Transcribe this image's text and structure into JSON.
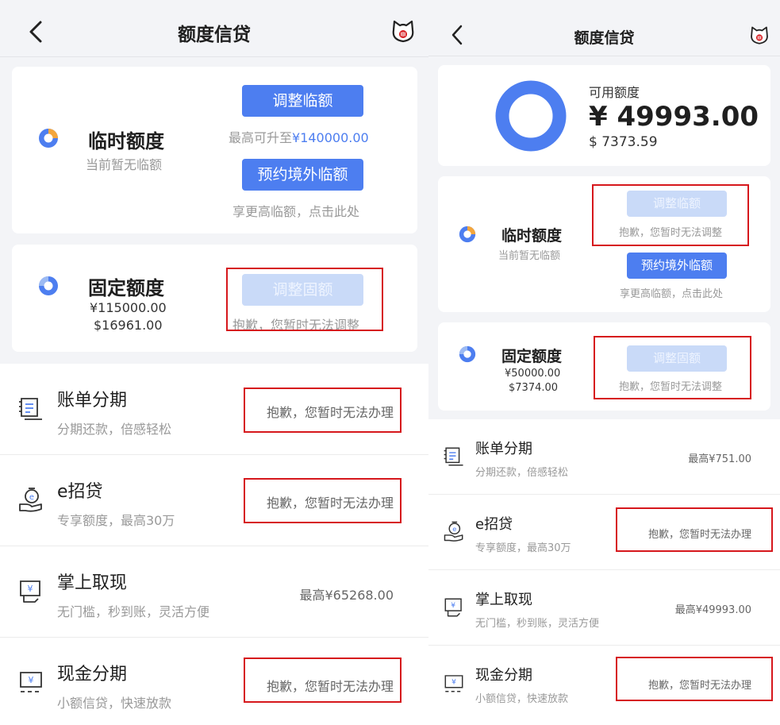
{
  "left": {
    "nav": {
      "title": "额度信贷"
    },
    "temp_card": {
      "title": "临时额度",
      "subtitle": "当前暂无临额",
      "btn_adjust": "调整临额",
      "max_prefix": "最高可升至",
      "max_value": "¥140000.00",
      "btn_overseas": "预约境外临额",
      "overseas_hint": "享更高临额，点击此处"
    },
    "fixed_card": {
      "title": "固定额度",
      "amount_cny": "¥115000.00",
      "amount_usd": "$16961.00",
      "btn_adjust": "调整固额",
      "notice": "抱歉，您暂时无法调整"
    },
    "items": [
      {
        "title": "账单分期",
        "subtitle": "分期还款，倍感轻松",
        "right": "抱歉，您暂时无法办理",
        "icon": "bill-installment-icon"
      },
      {
        "title": "e招贷",
        "subtitle": "专享额度，最高30万",
        "right": "抱歉，您暂时无法办理",
        "icon": "e-loan-icon"
      },
      {
        "title": "掌上取现",
        "subtitle": "无门槛，秒到账，灵活方便",
        "right": "最高¥65268.00",
        "icon": "cash-withdraw-icon"
      },
      {
        "title": "现金分期",
        "subtitle": "小额信贷，快速放款",
        "right": "抱歉，您暂时无法办理",
        "icon": "cash-installment-icon"
      }
    ]
  },
  "right": {
    "nav": {
      "title": "额度信贷"
    },
    "available": {
      "label": "可用额度",
      "amount_cny": "¥ 49993.00",
      "amount_usd": "$ 7373.59"
    },
    "temp_card": {
      "title": "临时额度",
      "subtitle": "当前暂无临额",
      "btn_adjust": "调整临额",
      "notice": "抱歉，您暂时无法调整",
      "btn_overseas": "预约境外临额",
      "overseas_hint": "享更高临额，点击此处"
    },
    "fixed_card": {
      "title": "固定额度",
      "amount_cny": "¥50000.00",
      "amount_usd": "$7374.00",
      "btn_adjust": "调整固额",
      "notice": "抱歉，您暂时无法调整"
    },
    "items": [
      {
        "title": "账单分期",
        "subtitle": "分期还款，倍感轻松",
        "right": "最高¥751.00",
        "icon": "bill-installment-icon"
      },
      {
        "title": "e招贷",
        "subtitle": "专享额度，最高30万",
        "right": "抱歉，您暂时无法办理",
        "icon": "e-loan-icon"
      },
      {
        "title": "掌上取现",
        "subtitle": "无门槛，秒到账，灵活方便",
        "right": "最高¥49993.00",
        "icon": "cash-withdraw-icon"
      },
      {
        "title": "现金分期",
        "subtitle": "小额信贷，快速放款",
        "right": "抱歉，您暂时无法办理",
        "icon": "cash-installment-icon"
      }
    ]
  },
  "colors": {
    "accent": "#4d7ef0",
    "disabled": "#c9daf8",
    "annotation": "#d6171c",
    "background": "#f3f4f7"
  }
}
